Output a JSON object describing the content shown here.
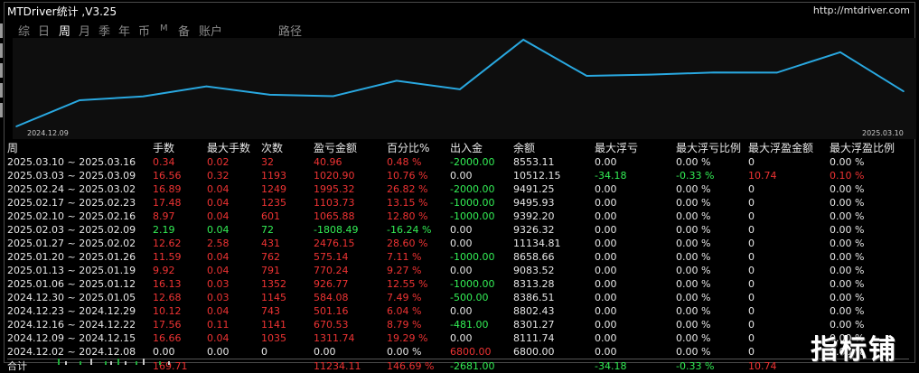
{
  "window": {
    "title": "MTDriver统计 ,V3.25",
    "url": "http://mtdriver.com"
  },
  "tabs": [
    {
      "label": "综",
      "active": false
    },
    {
      "label": "日",
      "active": false
    },
    {
      "label": "周",
      "active": true
    },
    {
      "label": "月",
      "active": false
    },
    {
      "label": "季",
      "active": false
    },
    {
      "label": "年",
      "active": false
    },
    {
      "label": "币",
      "active": false
    },
    {
      "label": "M",
      "active": false
    },
    {
      "label": "备",
      "active": false
    },
    {
      "label": "账户",
      "active": false
    },
    {
      "label": "路径",
      "active": false
    }
  ],
  "chart_data": {
    "type": "line",
    "x": [
      "2024.12.02",
      "2024.12.09",
      "2024.12.16",
      "2024.12.23",
      "2024.12.30",
      "2025.01.06",
      "2025.01.13",
      "2025.01.20",
      "2025.01.27",
      "2025.02.03",
      "2025.02.10",
      "2025.02.17",
      "2025.02.24",
      "2025.03.03",
      "2025.03.10"
    ],
    "values": [
      6800.0,
      8111.74,
      8301.27,
      8802.43,
      8386.51,
      8313.28,
      9083.52,
      8658.66,
      11134.81,
      9326.32,
      9392.2,
      9495.93,
      9491.25,
      10512.15,
      8553.11
    ],
    "series_color": "#29a8e0",
    "start_label": "2024.12.09",
    "end_label": "2025.03.10"
  },
  "table": {
    "headers": [
      "周",
      "手数",
      "最大手数",
      "次数",
      "盈亏金额",
      "百分比%",
      "出入金",
      "余额",
      "最大浮亏",
      "最大浮亏比例",
      "最大浮盈金额",
      "最大浮盈比例"
    ],
    "rows": [
      {
        "cells": [
          "2025.03.10 ~ 2025.03.16",
          "0.34",
          "0.02",
          "32",
          "40.96",
          "0.48 %",
          "-2000.00",
          "8553.11",
          "0.00",
          "0.00 %",
          "0",
          "0.00 %"
        ],
        "colors": [
          "w",
          "r",
          "r",
          "r",
          "r",
          "r",
          "g",
          "w",
          "w",
          "w",
          "w",
          "w"
        ]
      },
      {
        "cells": [
          "2025.03.03 ~ 2025.03.09",
          "16.56",
          "0.32",
          "1193",
          "1020.90",
          "10.76 %",
          "0.00",
          "10512.15",
          "-34.18",
          "-0.33 %",
          "10.74",
          "0.10 %"
        ],
        "colors": [
          "w",
          "r",
          "r",
          "r",
          "r",
          "r",
          "w",
          "w",
          "g",
          "g",
          "r",
          "r"
        ]
      },
      {
        "cells": [
          "2025.02.24 ~ 2025.03.02",
          "16.89",
          "0.04",
          "1249",
          "1995.32",
          "26.82 %",
          "-2000.00",
          "9491.25",
          "0.00",
          "0.00 %",
          "0",
          "0.00 %"
        ],
        "colors": [
          "w",
          "r",
          "r",
          "r",
          "r",
          "r",
          "g",
          "w",
          "w",
          "w",
          "w",
          "w"
        ]
      },
      {
        "cells": [
          "2025.02.17 ~ 2025.02.23",
          "17.48",
          "0.04",
          "1235",
          "1103.73",
          "13.15 %",
          "-1000.00",
          "9495.93",
          "0.00",
          "0.00 %",
          "0",
          "0.00 %"
        ],
        "colors": [
          "w",
          "r",
          "r",
          "r",
          "r",
          "r",
          "g",
          "w",
          "w",
          "w",
          "w",
          "w"
        ]
      },
      {
        "cells": [
          "2025.02.10 ~ 2025.02.16",
          "8.97",
          "0.04",
          "601",
          "1065.88",
          "12.80 %",
          "-1000.00",
          "9392.20",
          "0.00",
          "0.00 %",
          "0",
          "0.00 %"
        ],
        "colors": [
          "w",
          "r",
          "r",
          "r",
          "r",
          "r",
          "g",
          "w",
          "w",
          "w",
          "w",
          "w"
        ]
      },
      {
        "cells": [
          "2025.02.03 ~ 2025.02.09",
          "2.19",
          "0.04",
          "72",
          "-1808.49",
          "-16.24 %",
          "0.00",
          "9326.32",
          "0.00",
          "0.00 %",
          "0",
          "0.00 %"
        ],
        "colors": [
          "w",
          "g",
          "g",
          "g",
          "g",
          "g",
          "w",
          "w",
          "w",
          "w",
          "w",
          "w"
        ]
      },
      {
        "cells": [
          "2025.01.27 ~ 2025.02.02",
          "12.62",
          "2.58",
          "431",
          "2476.15",
          "28.60 %",
          "0.00",
          "11134.81",
          "0.00",
          "0.00 %",
          "0",
          "0.00 %"
        ],
        "colors": [
          "w",
          "r",
          "r",
          "r",
          "r",
          "r",
          "w",
          "w",
          "w",
          "w",
          "w",
          "w"
        ]
      },
      {
        "cells": [
          "2025.01.20 ~ 2025.01.26",
          "11.59",
          "0.04",
          "762",
          "575.14",
          "7.11 %",
          "-1000.00",
          "8658.66",
          "0.00",
          "0.00 %",
          "0",
          "0.00 %"
        ],
        "colors": [
          "w",
          "r",
          "r",
          "r",
          "r",
          "r",
          "g",
          "w",
          "w",
          "w",
          "w",
          "w"
        ]
      },
      {
        "cells": [
          "2025.01.13 ~ 2025.01.19",
          "9.92",
          "0.04",
          "791",
          "770.24",
          "9.27 %",
          "0.00",
          "9083.52",
          "0.00",
          "0.00 %",
          "0",
          "0.00 %"
        ],
        "colors": [
          "w",
          "r",
          "r",
          "r",
          "r",
          "r",
          "w",
          "w",
          "w",
          "w",
          "w",
          "w"
        ]
      },
      {
        "cells": [
          "2025.01.06 ~ 2025.01.12",
          "16.13",
          "0.03",
          "1352",
          "926.77",
          "12.55 %",
          "-1000.00",
          "8313.28",
          "0.00",
          "0.00 %",
          "0",
          "0.00 %"
        ],
        "colors": [
          "w",
          "r",
          "r",
          "r",
          "r",
          "r",
          "g",
          "w",
          "w",
          "w",
          "w",
          "w"
        ]
      },
      {
        "cells": [
          "2024.12.30 ~ 2025.01.05",
          "12.68",
          "0.03",
          "1145",
          "584.08",
          "7.49 %",
          "-500.00",
          "8386.51",
          "0.00",
          "0.00 %",
          "0",
          "0.00 %"
        ],
        "colors": [
          "w",
          "r",
          "r",
          "r",
          "r",
          "r",
          "g",
          "w",
          "w",
          "w",
          "w",
          "w"
        ]
      },
      {
        "cells": [
          "2024.12.23 ~ 2024.12.29",
          "10.12",
          "0.04",
          "743",
          "501.16",
          "6.04 %",
          "0.00",
          "8802.43",
          "0.00",
          "0.00 %",
          "0",
          "0.00 %"
        ],
        "colors": [
          "w",
          "r",
          "r",
          "r",
          "r",
          "r",
          "w",
          "w",
          "w",
          "w",
          "w",
          "w"
        ]
      },
      {
        "cells": [
          "2024.12.16 ~ 2024.12.22",
          "17.56",
          "0.11",
          "1141",
          "670.53",
          "8.79 %",
          "-481.00",
          "8301.27",
          "0.00",
          "0.00 %",
          "0",
          "0.00 %"
        ],
        "colors": [
          "w",
          "r",
          "r",
          "r",
          "r",
          "r",
          "g",
          "w",
          "w",
          "w",
          "w",
          "w"
        ]
      },
      {
        "cells": [
          "2024.12.09 ~ 2024.12.15",
          "16.66",
          "0.04",
          "1035",
          "1311.74",
          "19.29 %",
          "0.00",
          "8111.74",
          "0.00",
          "0.00 %",
          "0",
          "0.00 %"
        ],
        "colors": [
          "w",
          "r",
          "r",
          "r",
          "r",
          "r",
          "w",
          "w",
          "w",
          "w",
          "w",
          "w"
        ]
      },
      {
        "cells": [
          "2024.12.02 ~ 2024.12.08",
          "0.00",
          "0.00",
          "0",
          "0.00",
          "0.00 %",
          "6800.00",
          "6800.00",
          "0.00",
          "0.00 %",
          "0",
          "0.00 %"
        ],
        "colors": [
          "w",
          "w",
          "w",
          "w",
          "w",
          "w",
          "r",
          "w",
          "w",
          "w",
          "w",
          "w"
        ]
      }
    ],
    "total": {
      "cells": [
        "合计",
        "169.71",
        "",
        "",
        "11234.11",
        "146.69 %",
        "-2681.00",
        "",
        "-34.18",
        "-0.33 %",
        "10.74",
        ""
      ],
      "colors": [
        "w",
        "r",
        "w",
        "w",
        "r",
        "r",
        "g",
        "w",
        "g",
        "g",
        "r",
        "w"
      ]
    }
  },
  "watermark": "指标铺",
  "colors": {
    "red": "#ee3333",
    "green": "#33ee55",
    "white": "#e6e6e6",
    "line": "#29a8e0"
  }
}
